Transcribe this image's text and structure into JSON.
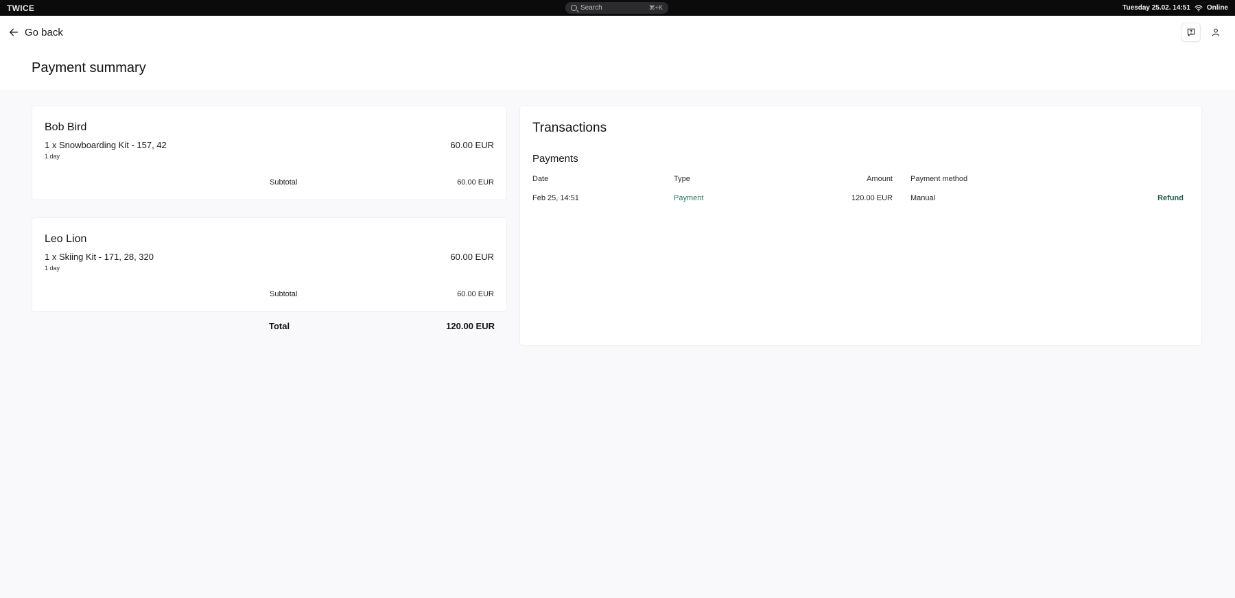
{
  "system_bar": {
    "logo": "TWICE",
    "search_placeholder": "Search",
    "search_shortcut": "⌘+K",
    "datetime": "Tuesday 25.02. 14:51",
    "status": "Online"
  },
  "header": {
    "back_label": "Go back",
    "title": "Payment summary"
  },
  "orders": [
    {
      "customer": "Bob Bird",
      "item": "1 x Snowboarding Kit - 157, 42",
      "price": "60.00 EUR",
      "duration": "1 day",
      "subtotal_label": "Subtotal",
      "subtotal": "60.00 EUR"
    },
    {
      "customer": "Leo Lion",
      "item": "1 x Skiing Kit - 171, 28, 320",
      "price": "60.00 EUR",
      "duration": "1 day",
      "subtotal_label": "Subtotal",
      "subtotal": "60.00 EUR"
    }
  ],
  "total": {
    "label": "Total",
    "value": "120.00 EUR"
  },
  "transactions": {
    "title": "Transactions",
    "subtitle": "Payments",
    "columns": {
      "date": "Date",
      "type": "Type",
      "amount": "Amount",
      "method": "Payment method"
    },
    "rows": [
      {
        "date": "Feb 25, 14:51",
        "type": "Payment",
        "amount": "120.00 EUR",
        "method": "Manual",
        "action": "Refund"
      }
    ]
  },
  "colors": {
    "accent": "#1f7a6a",
    "background": "#f9f8fb",
    "topbar": "#0b0b0c"
  },
  "icons": {
    "back": "arrow-left-icon",
    "help": "chat-question-icon",
    "user": "user-icon",
    "search": "search-icon",
    "wifi": "wifi-icon"
  }
}
